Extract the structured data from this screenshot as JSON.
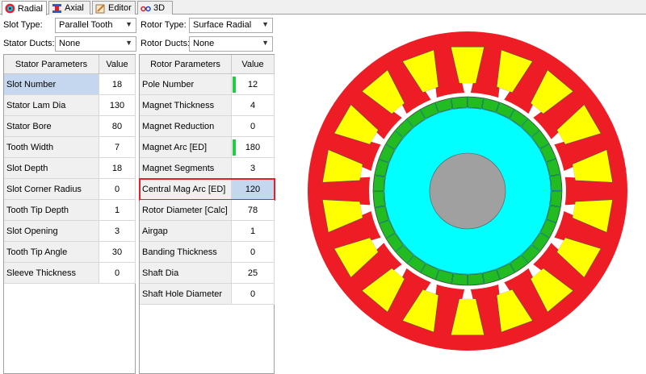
{
  "tabs": [
    {
      "label": "Radial",
      "icon": "radial-icon",
      "active": true
    },
    {
      "label": "Axial",
      "icon": "axial-icon",
      "active": false
    },
    {
      "label": "Editor",
      "icon": "editor-icon",
      "active": false
    },
    {
      "label": "3D",
      "icon": "glasses-3d-icon",
      "active": false
    }
  ],
  "selectors": {
    "slot_type": {
      "label": "Slot Type:",
      "value": "Parallel Tooth"
    },
    "stator_ducts": {
      "label": "Stator Ducts:",
      "value": "None"
    },
    "rotor_type": {
      "label": "Rotor Type:",
      "value": "Surface Radial"
    },
    "rotor_ducts": {
      "label": "Rotor Ducts:",
      "value": "None"
    }
  },
  "stator_table": {
    "header_name": "Stator Parameters",
    "header_value": "Value",
    "rows": [
      {
        "name": "Slot Number",
        "value": "18"
      },
      {
        "name": "Stator Lam Dia",
        "value": "130"
      },
      {
        "name": "Stator Bore",
        "value": "80"
      },
      {
        "name": "Tooth Width",
        "value": "7"
      },
      {
        "name": "Slot Depth",
        "value": "18"
      },
      {
        "name": "Slot Corner Radius",
        "value": "0"
      },
      {
        "name": "Tooth Tip Depth",
        "value": "1"
      },
      {
        "name": "Slot Opening",
        "value": "3"
      },
      {
        "name": "Tooth Tip Angle",
        "value": "30"
      },
      {
        "name": "Sleeve Thickness",
        "value": "0"
      }
    ]
  },
  "rotor_table": {
    "header_name": "Rotor Parameters",
    "header_value": "Value",
    "rows": [
      {
        "name": "Pole Number",
        "value": "12"
      },
      {
        "name": "Magnet Thickness",
        "value": "4"
      },
      {
        "name": "Magnet Reduction",
        "value": "0"
      },
      {
        "name": "Magnet Arc [ED]",
        "value": "180"
      },
      {
        "name": "Magnet Segments",
        "value": "3"
      },
      {
        "name": "Central Mag Arc [ED]",
        "value": "120"
      },
      {
        "name": "Rotor Diameter [Calc]",
        "value": "78"
      },
      {
        "name": "Airgap",
        "value": "1"
      },
      {
        "name": "Banding Thickness",
        "value": "0"
      },
      {
        "name": "Shaft Dia",
        "value": "25"
      },
      {
        "name": "Shaft Hole Diameter",
        "value": "0"
      }
    ]
  },
  "motor": {
    "slots": 18,
    "poles": 12,
    "magnet_segments": 3,
    "colors": {
      "stator": "#ee1c24",
      "winding": "#ffff00",
      "rotor": "#00ffff",
      "magnet": "#22bb22",
      "magnet_arrow": "#ff6a00",
      "shaft": "#a0a0a0",
      "slot_gap": "#ffffff"
    }
  },
  "colors": {
    "highlight_border": "#e0202a",
    "selected_cell": "#c5d7ee",
    "green_marker": "#22cc44"
  }
}
